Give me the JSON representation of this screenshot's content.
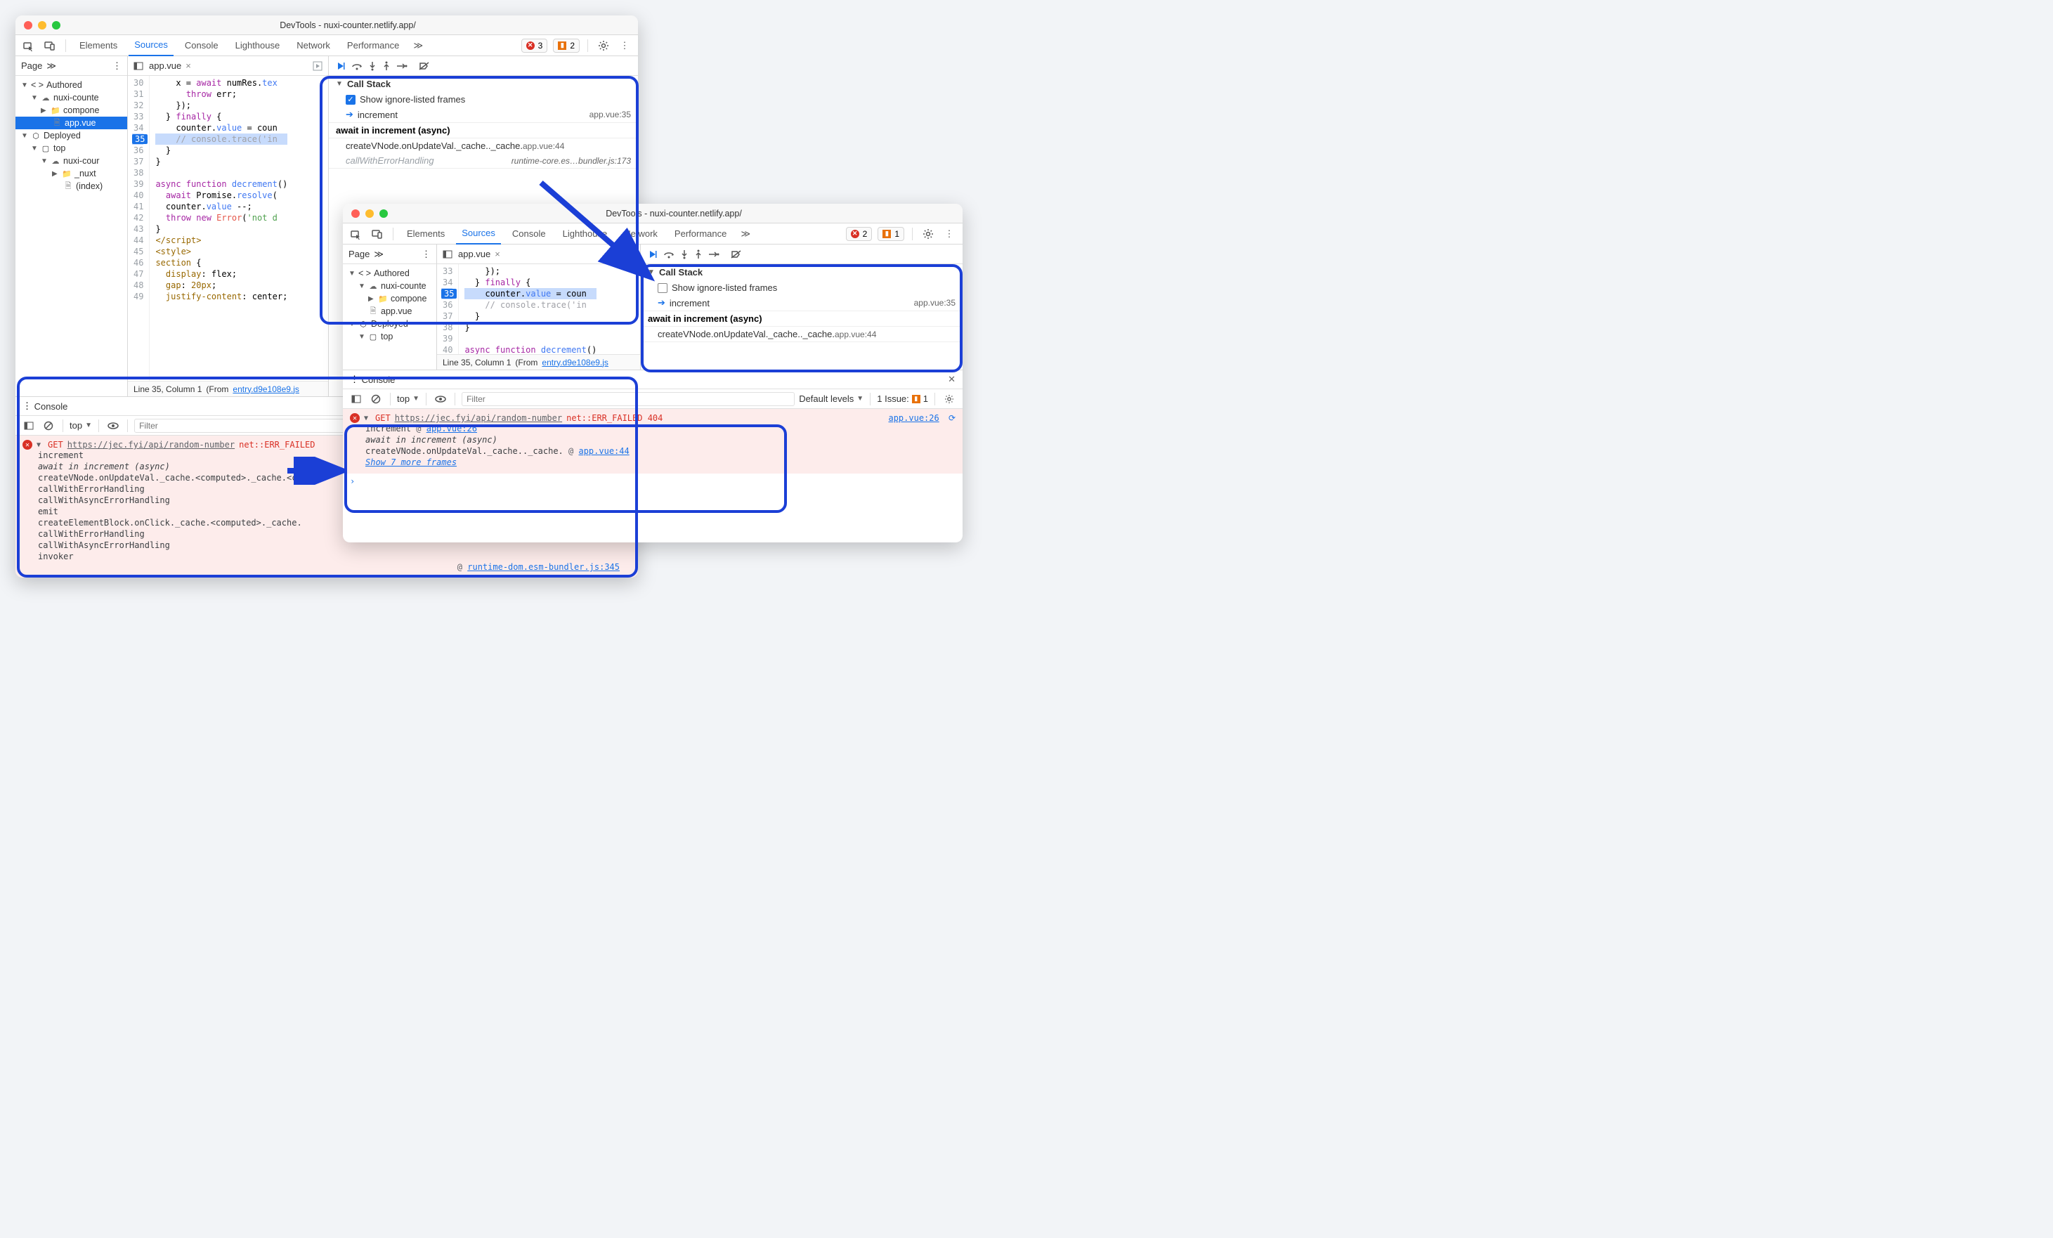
{
  "window1": {
    "title": "DevTools - nuxi-counter.netlify.app/",
    "tabs": [
      "Elements",
      "Sources",
      "Console",
      "Lighthouse",
      "Network",
      "Performance"
    ],
    "active_tab": "Sources",
    "errors_count": "3",
    "warnings_count": "2",
    "page_tab": "Page",
    "file_tab": "app.vue",
    "tree": {
      "authored": "Authored",
      "nuxi": "nuxi-counte",
      "compone": "compone",
      "appvue": "app.vue",
      "deployed": "Deployed",
      "top": "top",
      "nuxi2": "nuxi-cour",
      "nuxt": "_nuxt",
      "index": "(index)"
    },
    "gutter_start": 30,
    "code_lines_html": [
      "    x = <span class='tok-kw'>await</span> numRes.<span class='tok-fn'>tex</span>",
      "      <span class='tok-kw'>throw</span> err;",
      "    });",
      "  } <span class='tok-kw'>finally</span> {",
      "    counter.<span class='tok-fn'>value</span> = coun",
      "    <span class='tok-com'>// console.trace('in</span>",
      "  }",
      "}",
      "",
      "<span class='tok-kw'>async function</span> <span class='tok-fn'>decrement</span>()",
      "  <span class='tok-kw'>await</span> Promise.<span class='tok-fn'>resolve</span>(",
      "  counter.<span class='tok-fn'>value</span> --;",
      "  <span class='tok-kw'>throw new</span> <span class='tok-err'>Error</span>(<span class='tok-str'>'not d</span>",
      "}",
      "<span class='tok-tag'>&lt;/script&gt;</span>",
      "<span class='tok-tag'>&lt;style&gt;</span>",
      "<span class='tok-prop'>section</span> {",
      "  <span class='tok-prop'>display</span>: flex;",
      "  <span class='tok-prop'>gap</span>: <span class='tok-num'>20px</span>;",
      "  <span class='tok-prop'>justify-content</span>: center;"
    ],
    "highlight_line": 35,
    "status": {
      "pos": "Line 35, Column 1",
      "from": "(From",
      "file": "entry.d9e108e9.js"
    },
    "callstack": {
      "title": "Call Stack",
      "show_ignored_label": "Show ignore-listed frames",
      "show_ignored_checked": true,
      "frames": [
        {
          "name": "increment",
          "loc": "app.vue:35",
          "current": true
        },
        {
          "separator": "await in increment (async)"
        },
        {
          "name": "createVNode.onUpdateVal._cache.<computed>._cache.<com…",
          "loc": "app.vue:44"
        },
        {
          "name": "callWithErrorHandling",
          "loc": "runtime-core.es…bundler.js:173",
          "ignored": true
        }
      ]
    },
    "console": {
      "title": "Console",
      "context": "top",
      "filter_ph": "Filter",
      "error": {
        "verb": "GET",
        "url": "https://jec.fyi/api/random-number",
        "status": "net::ERR_FAILED",
        "stack": [
          {
            "text": "increment"
          },
          {
            "text": "await in increment (async)",
            "italic": true
          },
          {
            "text": "createVNode.onUpdateVal._cache.<computed>._cache.<co"
          },
          {
            "text": "callWithErrorHandling"
          },
          {
            "text": "callWithAsyncErrorHandling"
          },
          {
            "text": "emit"
          },
          {
            "text": "createElementBlock.onClick._cache.<computed>._cache."
          },
          {
            "text": "callWithErrorHandling"
          },
          {
            "text": "callWithAsyncErrorHandling"
          },
          {
            "text": "invoker"
          }
        ],
        "right_link": "runtime-dom.esm-bundler.js:345"
      }
    }
  },
  "window2": {
    "title": "DevTools - nuxi-counter.netlify.app/",
    "tabs": [
      "Elements",
      "Sources",
      "Console",
      "Lighthouse",
      "Network",
      "Performance"
    ],
    "active_tab": "Sources",
    "errors_count": "2",
    "warnings_count": "1",
    "page_tab": "Page",
    "file_tab": "app.vue",
    "tree": {
      "authored": "Authored",
      "nuxi": "nuxi-counte",
      "compone": "compone",
      "appvue": "app.vue",
      "deployed": "Deployed",
      "top": "top"
    },
    "gutter_start": 33,
    "code_lines_html": [
      "    });",
      "  } <span class='tok-kw'>finally</span> {",
      "    counter.<span class='tok-fn'>value</span> = coun",
      "    <span class='tok-com'>// console.trace('in</span>",
      "  }",
      "}",
      "",
      "<span class='tok-kw'>async function</span> <span class='tok-fn'>decrement</span>()"
    ],
    "highlight_line": 35,
    "status": {
      "pos": "Line 35, Column 1",
      "from": "(From",
      "file": "entry.d9e108e9.js"
    },
    "callstack": {
      "title": "Call Stack",
      "show_ignored_label": "Show ignore-listed frames",
      "show_ignored_checked": false,
      "frames": [
        {
          "name": "increment",
          "loc": "app.vue:35",
          "current": true
        },
        {
          "separator": "await in increment (async)"
        },
        {
          "name": "createVNode.onUpdateVal._cache.<computed>._cache.<com…",
          "loc": "app.vue:44"
        }
      ]
    },
    "console": {
      "title": "Console",
      "context": "top",
      "filter_ph": "Filter",
      "levels": "Default levels",
      "issues_label": "1 Issue:",
      "issues_count": "1",
      "error": {
        "verb": "GET",
        "url": "https://jec.fyi/api/random-number",
        "status": "net::ERR_FAILED 404",
        "right_link": "app.vue:26",
        "stack": [
          {
            "text": "increment",
            "loc": "app.vue:26"
          },
          {
            "text": "await in increment (async)",
            "italic": true
          },
          {
            "text": "createVNode.onUpdateVal._cache.<computed>._cache.<computed>",
            "loc": "app.vue:44"
          }
        ],
        "more": "Show 7 more frames"
      }
    }
  }
}
